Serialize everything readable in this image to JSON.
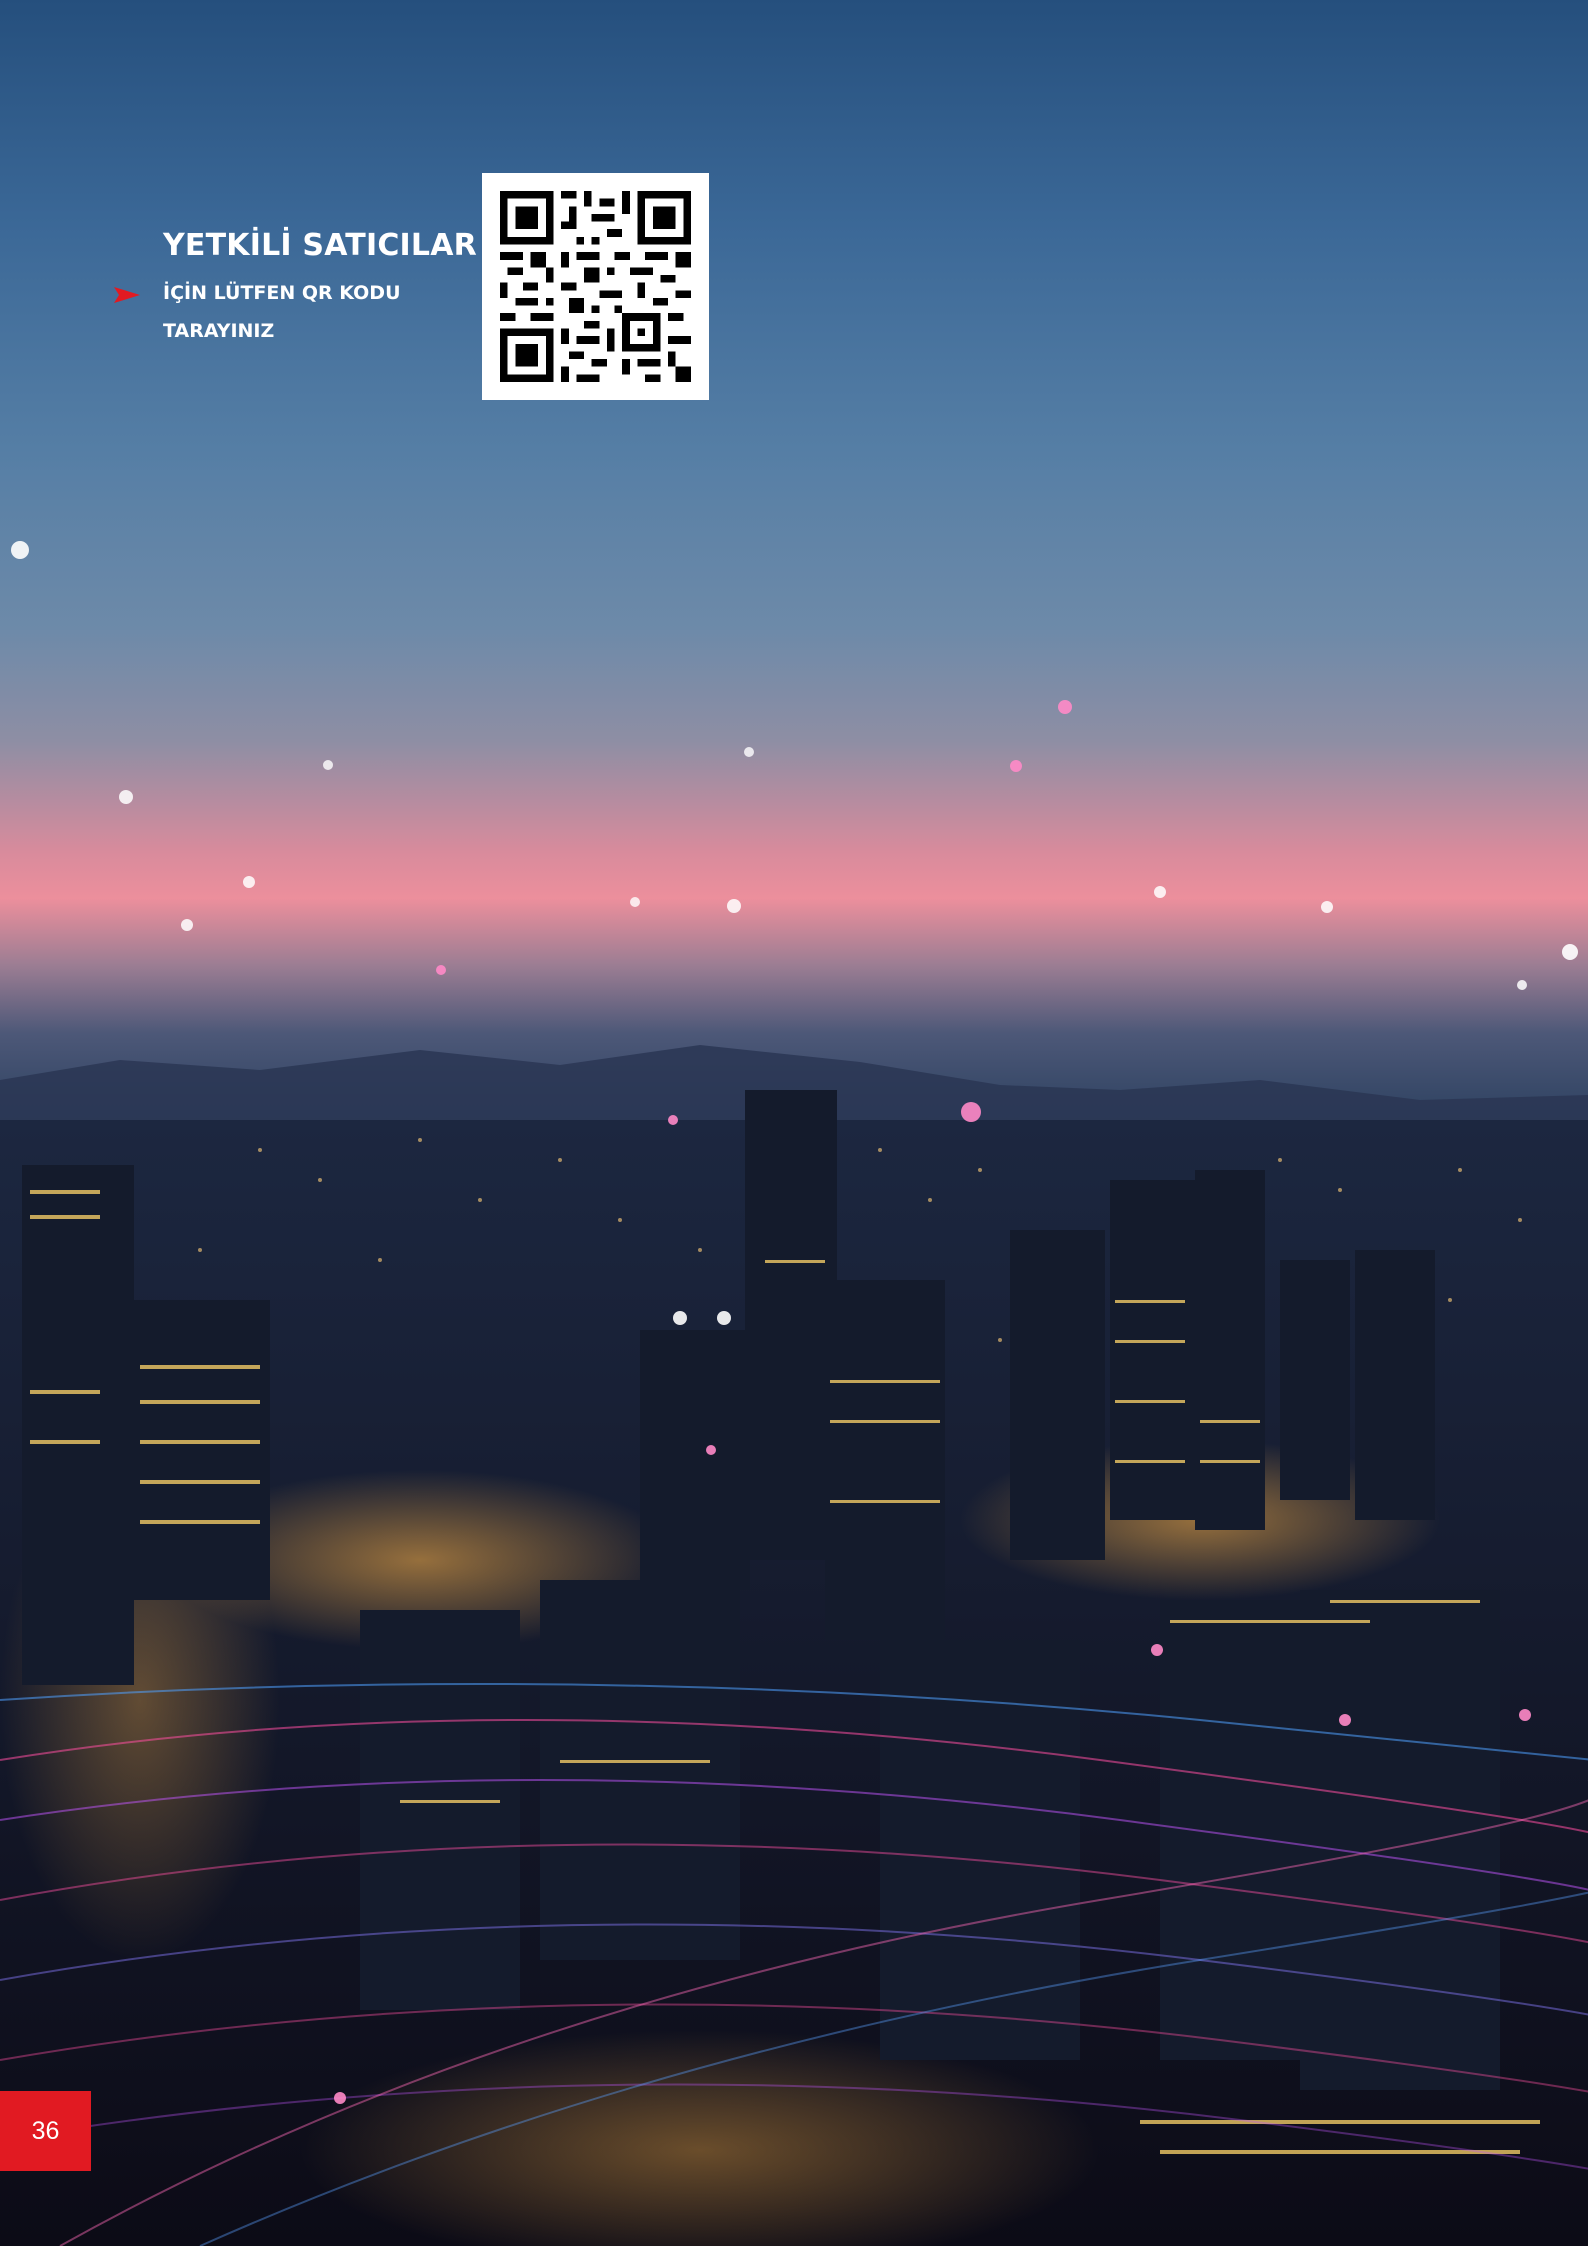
{
  "header": {
    "title": "YETKİLİ SATICILAR",
    "subtitle_line1": "İÇİN LÜTFEN QR KODU",
    "subtitle_line2": "TARAYINIZ"
  },
  "qr": {
    "icon": "qr-code-icon"
  },
  "footer": {
    "page_number": "36"
  },
  "colors": {
    "accent": "#e11a22",
    "text": "#ffffff"
  }
}
